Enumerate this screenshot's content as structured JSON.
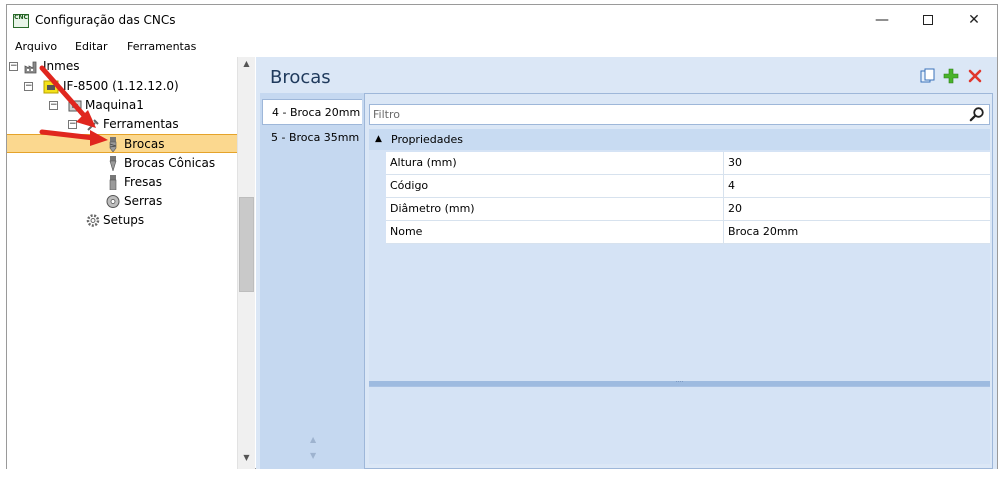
{
  "window": {
    "title": "Configuração das CNCs",
    "app_icon_text": "CNC",
    "icons": [
      "app-icon",
      "minimize-icon",
      "maximize-icon",
      "close-icon"
    ]
  },
  "menu": {
    "items": [
      "Arquivo",
      "Editar",
      "Ferramentas"
    ]
  },
  "tree": {
    "nodes": [
      {
        "label": "Inmes",
        "icon": "factory-icon",
        "expander": "⊟"
      },
      {
        "label": "IF-8500 (1.12.12.0)",
        "icon": "cnc-machine-icon",
        "expander": "⊟"
      },
      {
        "label": "Maquina1",
        "icon": "machine-icon",
        "expander": "⊟"
      },
      {
        "label": "Ferramentas",
        "icon": "tools-icon",
        "expander": "⊟"
      },
      {
        "label": "Brocas",
        "icon": "drill-bit-icon",
        "selected": true
      },
      {
        "label": "Brocas Cônicas",
        "icon": "conical-drill-icon"
      },
      {
        "label": "Fresas",
        "icon": "milling-cutter-icon"
      },
      {
        "label": "Serras",
        "icon": "saw-blade-icon"
      },
      {
        "label": "Setups",
        "icon": "gear-icon"
      }
    ]
  },
  "main": {
    "title": "Brocas",
    "toolbar": {
      "copy_icon": "copy-icon",
      "add_icon": "add-icon",
      "delete_icon": "delete-icon"
    },
    "tabs": [
      {
        "label": "4 - Broca 20mm",
        "active": true
      },
      {
        "label": "5 - Broca 35mm",
        "active": false
      }
    ],
    "filter": {
      "placeholder": "Filtro",
      "value": ""
    },
    "category": "Propriedades",
    "properties": [
      {
        "name": "Altura (mm)",
        "value": "30"
      },
      {
        "name": "Código",
        "value": "4"
      },
      {
        "name": "Diâmetro (mm)",
        "value": "20"
      },
      {
        "name": "Nome",
        "value": "Broca 20mm"
      }
    ]
  },
  "colors": {
    "selection": "#fbd88f",
    "panel_bg": "#dbe7f6",
    "title_color": "#1f3a5c",
    "annotation_arrow": "#e0261e"
  }
}
